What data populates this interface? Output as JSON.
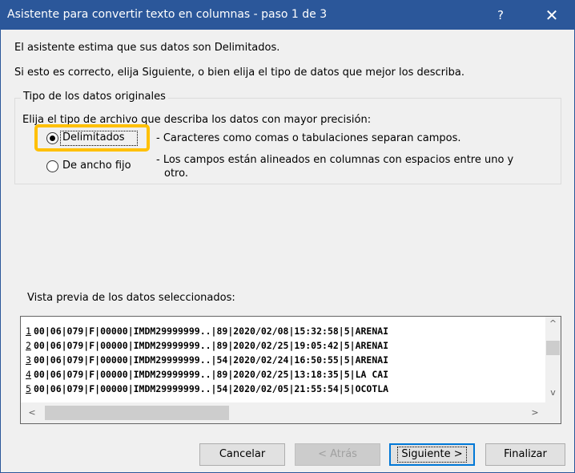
{
  "window": {
    "title": "Asistente para convertir texto en columnas - paso 1 de 3",
    "help_label": "?",
    "close_label": "✕"
  },
  "intro": {
    "line1": "El asistente estima que sus datos son Delimitados.",
    "line2": "Si esto es correcto, elija Siguiente, o bien elija el tipo de datos que mejor los describa."
  },
  "data_type_group": {
    "legend": "Tipo de los datos originales",
    "prompt": "Elija el tipo de archivo que describa los datos con mayor precisión:",
    "options": [
      {
        "label": "Delimitados",
        "description": "- Caracteres como comas o tabulaciones separan campos.",
        "selected": true
      },
      {
        "label": "De ancho fijo",
        "description_line1": "- Los campos están alineados en columnas con espacios entre uno y",
        "description_line2": "otro.",
        "selected": false
      }
    ]
  },
  "preview": {
    "label": "Vista previa de los datos seleccionados:",
    "rows": [
      {
        "num": "1",
        "text": "00|06|079|F|00000|IMDM29999999..|89|2020/02/08|15:32:58|5|ARENAI"
      },
      {
        "num": "2",
        "text": "00|06|079|F|00000|IMDM29999999..|89|2020/02/25|19:05:42|5|ARENAI"
      },
      {
        "num": "3",
        "text": "00|06|079|F|00000|IMDM29999999..|54|2020/02/24|16:50:55|5|ARENAI"
      },
      {
        "num": "4",
        "text": "00|06|079|F|00000|IMDM29999999..|89|2020/02/25|13:18:35|5|LA CAI"
      },
      {
        "num": "5",
        "text": "00|06|079|F|00000|IMDM29999999..|54|2020/02/05|21:55:54|5|OCOTLA"
      }
    ],
    "scroll_up": "^",
    "scroll_down": "v",
    "scroll_left": "<",
    "scroll_right": ">"
  },
  "buttons": {
    "cancel": "Cancelar",
    "back": "< Atrás",
    "next": "Siguiente >",
    "finish": "Finalizar"
  },
  "colors": {
    "titlebar": "#2b579a",
    "highlight": "#ffc000",
    "default_button_border": "#0078d7"
  }
}
